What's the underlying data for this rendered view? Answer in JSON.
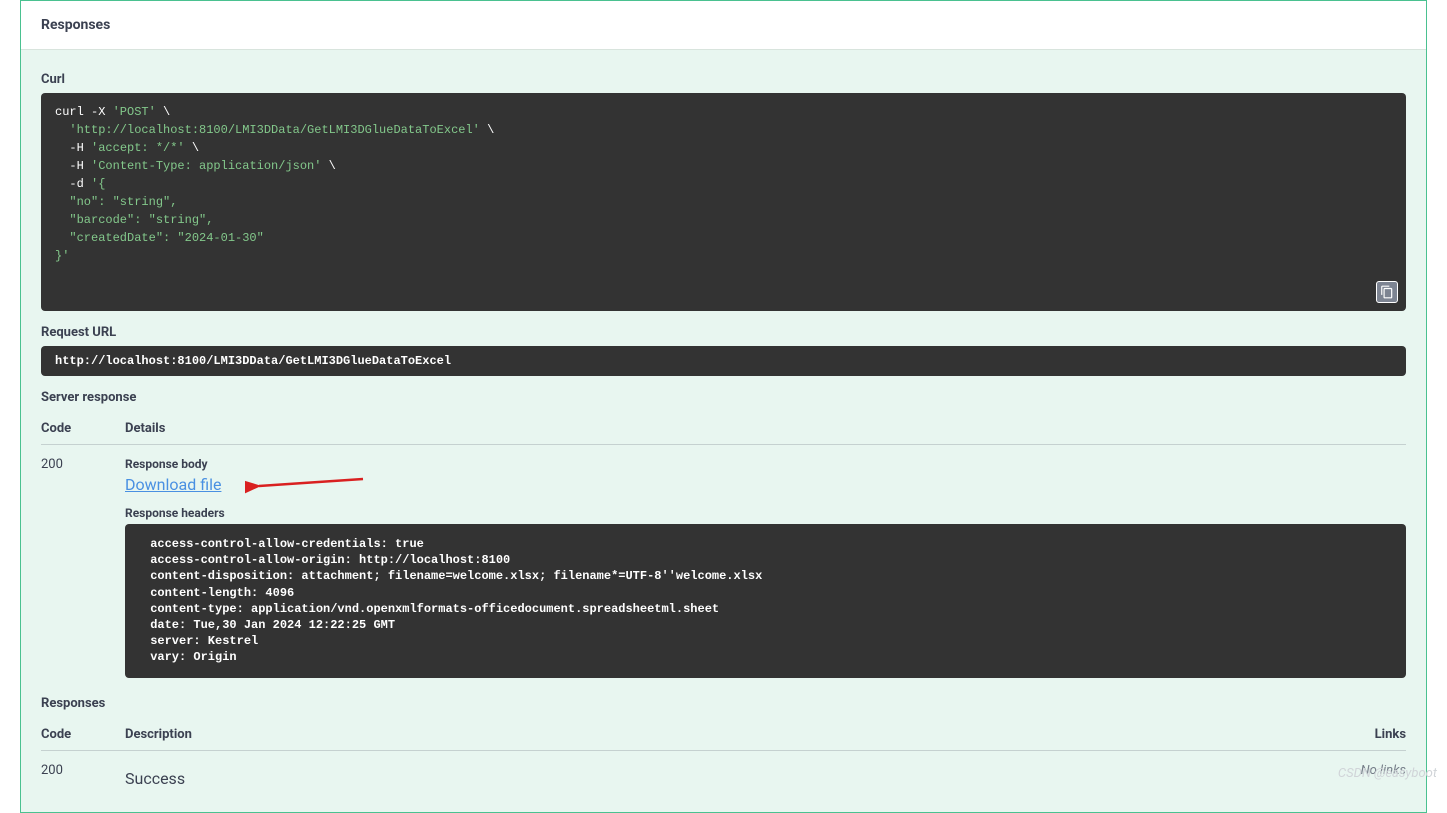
{
  "header": {
    "responses_title": "Responses"
  },
  "curl_section": {
    "label": "Curl",
    "line1_cmd": "curl -X ",
    "line1_str": "'POST'",
    "line1_end": " \\",
    "line2_str": "  'http://localhost:8100/LMI3DData/GetLMI3DGlueDataToExcel'",
    "line2_end": " \\",
    "line3_cmd": "  -H ",
    "line3_str": "'accept: */*'",
    "line3_end": " \\",
    "line4_cmd": "  -H ",
    "line4_str": "'Content-Type: application/json'",
    "line4_end": " \\",
    "line5_cmd": "  -d ",
    "line5_str": "'{\n  \"no\": \"string\",\n  \"barcode\": \"string\",\n  \"createdDate\": \"2024-01-30\"\n}'"
  },
  "request_url": {
    "label": "Request URL",
    "value": "http://localhost:8100/LMI3DData/GetLMI3DGlueDataToExcel"
  },
  "server_response": {
    "label": "Server response",
    "header_code": "Code",
    "header_details": "Details",
    "code": "200",
    "body_label": "Response body",
    "download_text": "Download file",
    "headers_label": "Response headers",
    "headers_content": " access-control-allow-credentials: true \n access-control-allow-origin: http://localhost:8100 \n content-disposition: attachment; filename=welcome.xlsx; filename*=UTF-8''welcome.xlsx \n content-length: 4096 \n content-type: application/vnd.openxmlformats-officedocument.spreadsheetml.sheet \n date: Tue,30 Jan 2024 12:22:25 GMT \n server: Kestrel \n vary: Origin "
  },
  "responses_list": {
    "label": "Responses",
    "header_code": "Code",
    "header_description": "Description",
    "header_links": "Links",
    "row_code": "200",
    "row_description": "Success",
    "row_links": "No links"
  },
  "watermark": "CSDN @easyboot"
}
